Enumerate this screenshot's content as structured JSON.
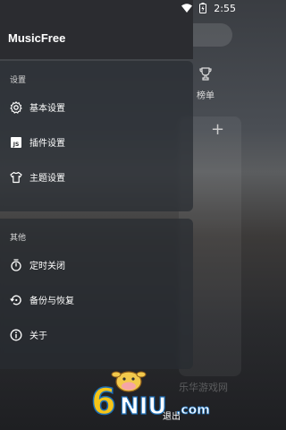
{
  "status_bar": {
    "time": "2:55"
  },
  "drawer": {
    "app_title": "MusicFree",
    "settings_section": {
      "title": "设置",
      "items": [
        {
          "label": "基本设置",
          "icon": "gear-icon"
        },
        {
          "label": "插件设置",
          "icon": "js-file-icon"
        },
        {
          "label": "主题设置",
          "icon": "tshirt-icon"
        }
      ]
    },
    "other_section": {
      "title": "其他",
      "items": [
        {
          "label": "定时关闭",
          "icon": "timer-icon"
        },
        {
          "label": "备份与恢复",
          "icon": "backup-restore-icon"
        },
        {
          "label": "关于",
          "icon": "info-icon"
        }
      ]
    },
    "logout_label": "退出"
  },
  "background": {
    "rank_label": "榜单",
    "faded_text": "乐华游戏网"
  },
  "watermark": {
    "text": "6NIU.com"
  }
}
